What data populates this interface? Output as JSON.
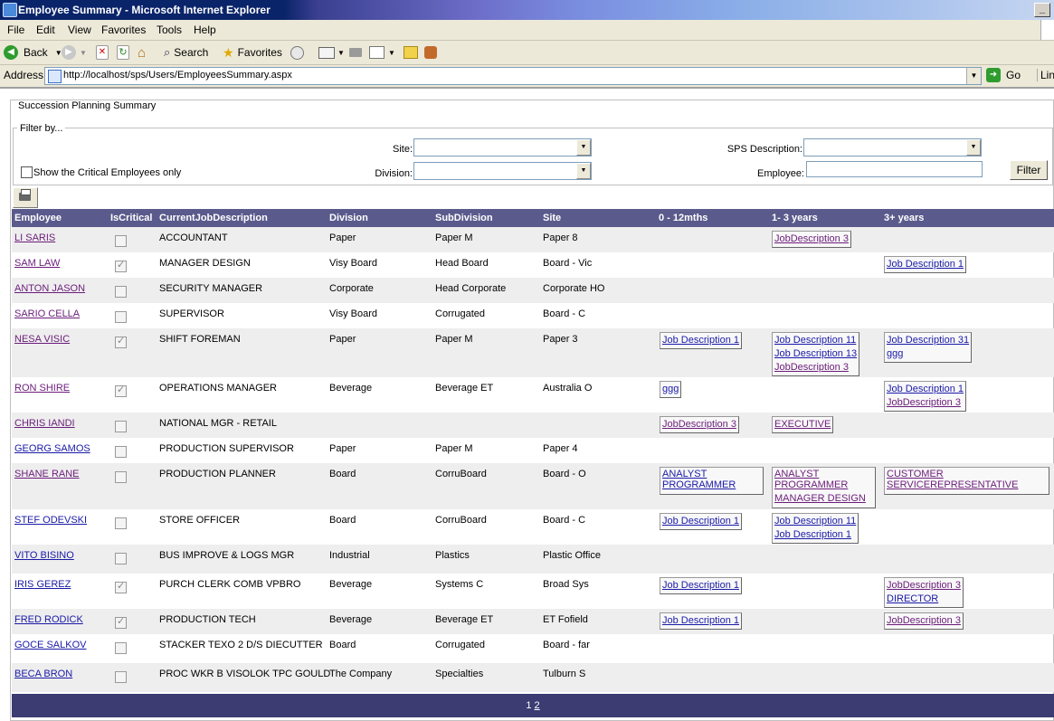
{
  "window": {
    "title": "Employee Summary - Microsoft Internet Explorer",
    "minimize": "_"
  },
  "menu": [
    "File",
    "Edit",
    "View",
    "Favorites",
    "Tools",
    "Help"
  ],
  "toolbar": {
    "back": "Back",
    "search": "Search",
    "favorites": "Favorites"
  },
  "address": {
    "label": "Address",
    "url": "http://localhost/sps/Users/EmployeesSummary.aspx",
    "go": "Go",
    "links": "Links"
  },
  "page": {
    "section_title": "Succession Planning Summary",
    "filter": {
      "legend": "Filter by...",
      "site_label": "Site:",
      "sps_label": "SPS Description:",
      "division_label": "Division:",
      "employee_label": "Employee:",
      "critical_only_label": "Show the Critical Employees only",
      "button": "Filter"
    }
  },
  "grid": {
    "columns": [
      "Employee",
      "IsCritical",
      "CurrentJobDescription",
      "Division",
      "SubDivision",
      "Site",
      "0 - 12mths",
      "1- 3 years",
      "3+ years"
    ],
    "rows": [
      {
        "employee": "LI SARIS",
        "critical": false,
        "job": "ACCOUNTANT",
        "division": "Paper",
        "subdivision": "Paper M",
        "site": "Paper 8",
        "m0": [],
        "y1": [
          "JobDescription 3"
        ],
        "y3": []
      },
      {
        "employee": "SAM LAW",
        "critical": true,
        "job": "MANAGER DESIGN",
        "division": "Visy Board",
        "subdivision": "Head Board",
        "site": "Board - Vic",
        "m0": [],
        "y1": [],
        "y3": [
          "Job Description 1"
        ]
      },
      {
        "employee": "ANTON JASON",
        "critical": false,
        "job": "SECURITY MANAGER",
        "division": "Corporate",
        "subdivision": "Head Corporate",
        "site": "Corporate HO",
        "m0": [],
        "y1": [],
        "y3": []
      },
      {
        "employee": "SARIO CELLA",
        "critical": false,
        "job": "SUPERVISOR",
        "division": "Visy Board",
        "subdivision": "Corrugated",
        "site": "Board - C",
        "m0": [],
        "y1": [],
        "y3": []
      },
      {
        "employee": "NESA VISIC",
        "critical": true,
        "job": "SHIFT FOREMAN",
        "division": "Paper",
        "subdivision": "Paper M",
        "site": "Paper 3",
        "m0": [
          "Job Description 1"
        ],
        "y1": [
          "Job Description 11",
          "Job Description 13",
          "JobDescription 3"
        ],
        "y3": [
          "Job Description 31",
          "ggg"
        ]
      },
      {
        "employee": "RON SHIRE",
        "critical": true,
        "job": "OPERATIONS MANAGER",
        "division": "Beverage",
        "subdivision": "Beverage ET",
        "site": "Australia O",
        "m0": [
          "ggg"
        ],
        "y1": [],
        "y3": [
          "Job Description 1",
          "JobDescription 3"
        ]
      },
      {
        "employee": "CHRIS IANDI",
        "critical": false,
        "job": "NATIONAL MGR - RETAIL",
        "division": "",
        "subdivision": "",
        "site": "",
        "m0": [
          "JobDescription 3"
        ],
        "y1": [
          "EXECUTIVE"
        ],
        "y3": []
      },
      {
        "employee": "GEORG SAMOS",
        "critical": false,
        "job": "PRODUCTION SUPERVISOR",
        "division": "Paper",
        "subdivision": "Paper M",
        "site": "Paper 4",
        "m0": [],
        "y1": [],
        "y3": []
      },
      {
        "employee": "SHANE RANE",
        "critical": false,
        "job": "PRODUCTION PLANNER",
        "division": "Board",
        "subdivision": "CorruBoard",
        "site": "Board - O",
        "m0": [
          "ANALYST PROGRAMMER"
        ],
        "y1": [
          "ANALYST PROGRAMMER",
          "MANAGER DESIGN"
        ],
        "y3": [
          "CUSTOMER SERVICEREPRESENTATIVE"
        ]
      },
      {
        "employee": "STEF ODEVSKI",
        "critical": false,
        "job": "STORE OFFICER",
        "division": "Board",
        "subdivision": "CorruBoard",
        "site": "Board - C",
        "m0": [
          "Job Description 1"
        ],
        "y1": [
          "Job Description 11",
          "Job Description 1"
        ],
        "y3": []
      },
      {
        "employee": "VITO BISINO",
        "critical": false,
        "job": "BUS IMPROVE & LOGS MGR",
        "division": "Industrial",
        "subdivision": "Plastics",
        "site": "Plastic Office",
        "m0": [],
        "y1": [],
        "y3": []
      },
      {
        "employee": "IRIS GEREZ",
        "critical": true,
        "job": "PURCH CLERK COMB VPBRO",
        "division": "Beverage",
        "subdivision": "Systems  C",
        "site": "Broad  Sys",
        "m0": [
          "Job Description 1"
        ],
        "y1": [],
        "y3": [
          "JobDescription 3",
          "DIRECTOR"
        ]
      },
      {
        "employee": "FRED RODICK",
        "critical": true,
        "job": "PRODUCTION TECH",
        "division": "Beverage",
        "subdivision": "Beverage  ET",
        "site": "ET Fofield",
        "m0": [
          "Job Description 1"
        ],
        "y1": [],
        "y3": [
          "JobDescription 3"
        ]
      },
      {
        "employee": "GOCE  SALKOV",
        "critical": false,
        "job": "STACKER TEXO 2 D/S DIECUTTER",
        "division": "Board",
        "subdivision": "Corrugated",
        "site": "Board - far",
        "m0": [],
        "y1": [],
        "y3": []
      },
      {
        "employee": "BECA BRON",
        "critical": false,
        "job": "PROC WKR B VISOLOK TPC GOULD",
        "division": "The Company",
        "subdivision": "Specialties",
        "site": "Tulburn S",
        "m0": [],
        "y1": [],
        "y3": []
      }
    ],
    "pager": {
      "current": "1",
      "next": "2"
    }
  }
}
